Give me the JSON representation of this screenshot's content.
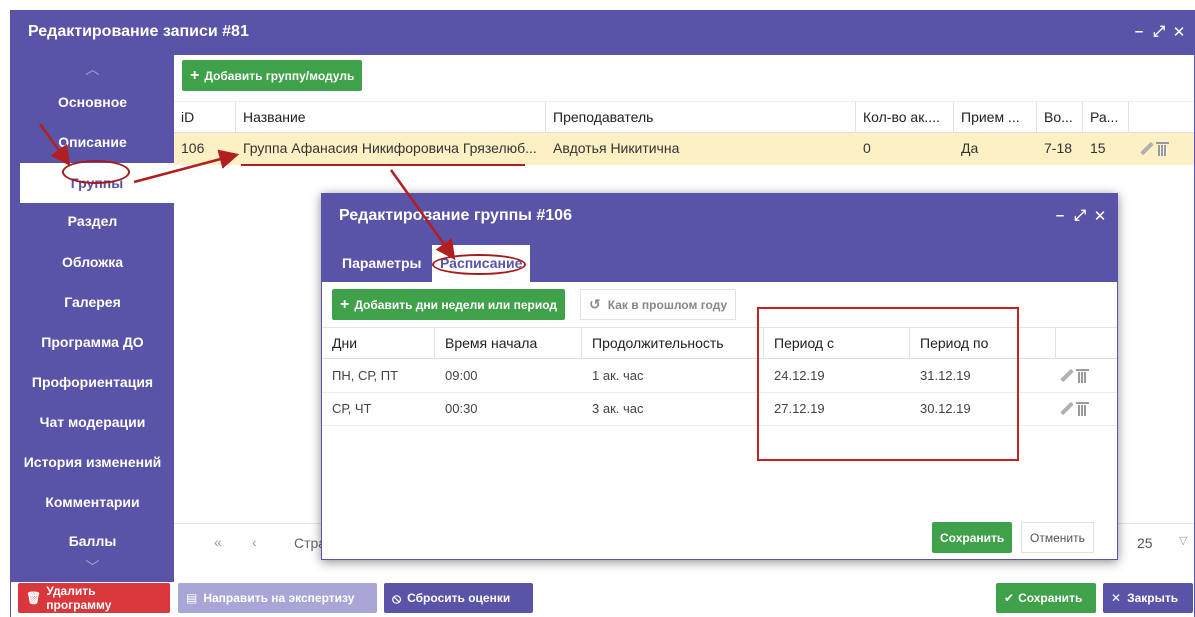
{
  "window": {
    "title": "Редактирование записи #81"
  },
  "sidebar": {
    "items": [
      {
        "label": "Основное"
      },
      {
        "label": "Описание"
      },
      {
        "label": "Группы"
      },
      {
        "label": "Раздел"
      },
      {
        "label": "Обложка"
      },
      {
        "label": "Галерея"
      },
      {
        "label": "Программа ДО"
      },
      {
        "label": "Профориентация"
      },
      {
        "label": "Чат модерации"
      },
      {
        "label": "История изменений"
      },
      {
        "label": "Комментарии"
      },
      {
        "label": "Баллы"
      }
    ]
  },
  "groups": {
    "add_label": "Добавить группу/модуль",
    "columns": [
      "iD",
      "Название",
      "Преподаватель",
      "Кол-во ак....",
      "Прием ...",
      "Во...",
      "Ра..."
    ],
    "row": {
      "id": "106",
      "name": "Группа Афанасия Никифоровича Грязелюб...",
      "teacher": "Авдотья Никитична",
      "count": "0",
      "admission": "Да",
      "age": "7-18",
      "size": "15"
    },
    "pager": {
      "label": "Стран",
      "page_size": "25"
    }
  },
  "modal": {
    "title": "Редактирование группы #106",
    "tabs": [
      "Параметры",
      "Расписание"
    ],
    "add_label": "Добавить дни недели или период",
    "copy_label": "Как в прошлом году",
    "columns": [
      "Дни",
      "Время начала",
      "Продолжительность",
      "Период с",
      "Период по"
    ],
    "rows": [
      {
        "days": "ПН, СР, ПТ",
        "start": "09:00",
        "duration": "1 ак. час",
        "from": "24.12.19",
        "to": "31.12.19"
      },
      {
        "days": "СР, ЧТ",
        "start": "00:30",
        "duration": "3 ак. час",
        "from": "27.12.19",
        "to": "30.12.19"
      }
    ],
    "save_label": "Сохранить",
    "cancel_label": "Отменить"
  },
  "footer": {
    "delete_label": "Удалить программу",
    "expertise_label": "Направить на экспертизу",
    "reset_label": "Сбросить оценки",
    "save_label": "Сохранить",
    "close_label": "Закрыть"
  },
  "colors": {
    "brand": "#5a54a8",
    "success": "#3fa14a",
    "danger": "#d9373c",
    "highlight_row": "#fdf0c4",
    "annotation": "#b21f1f"
  }
}
